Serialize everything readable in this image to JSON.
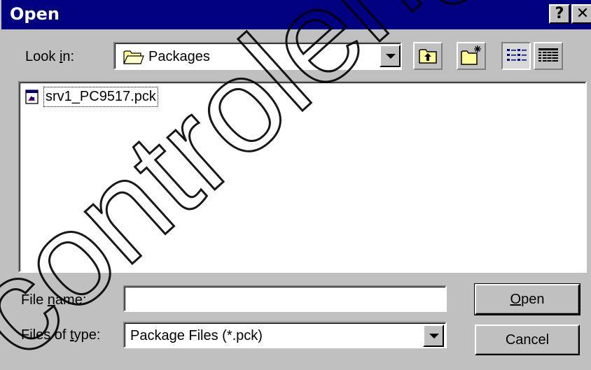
{
  "window": {
    "title": "Open",
    "help_glyph": "?",
    "close_glyph": "✕"
  },
  "look_in": {
    "label_before": "Look ",
    "label_accel": "i",
    "label_after": "n:",
    "value": "Packages",
    "icon": "folder-open-icon"
  },
  "toolbar": {
    "up_one_level": "up-folder-icon",
    "create_new_folder": "new-folder-icon",
    "list_view": "list-view-icon",
    "details_view": "details-view-icon",
    "active_view": "list"
  },
  "files": [
    {
      "name": "srv1_PC9517.pck",
      "icon": "package-file-icon"
    }
  ],
  "file_name": {
    "label_before": "File ",
    "label_accel": "n",
    "label_after": "ame:",
    "value": ""
  },
  "file_type": {
    "label_before": "Files of ",
    "label_accel": "t",
    "label_after": "ype:",
    "value": "Package Files (*.pck)"
  },
  "buttons": {
    "open_accel": "O",
    "open_rest": "pen",
    "cancel": "Cancel"
  },
  "watermark": {
    "text": "controlengeg"
  },
  "colors": {
    "titlebar": "#000080",
    "face": "#c0c0c0",
    "watermark": "#000000"
  }
}
